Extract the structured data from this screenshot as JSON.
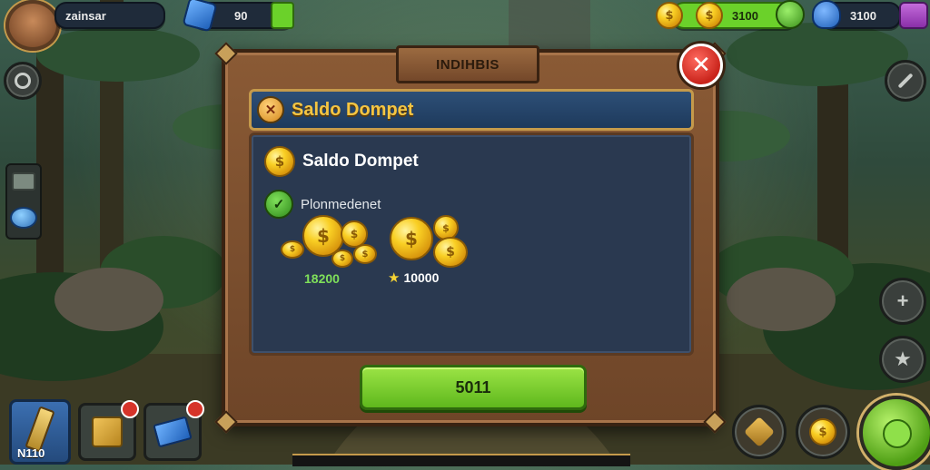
{
  "player": {
    "name": "zainsar"
  },
  "hud": {
    "gems": "90",
    "coins": "3100",
    "energy": "3100"
  },
  "dialog": {
    "title": "INDIHBIS",
    "header_label": "Saldo Dompet",
    "balance_label": "Saldo Dompet",
    "sub_label": "Plonmedenet",
    "reward1_value": "18200",
    "reward2_value": "10000",
    "confirm_label": "5011"
  },
  "bottom_left": {
    "weapon_count": "N110"
  },
  "icons": {
    "coin": "$",
    "close": "✕",
    "check": "✓",
    "star": "★"
  }
}
